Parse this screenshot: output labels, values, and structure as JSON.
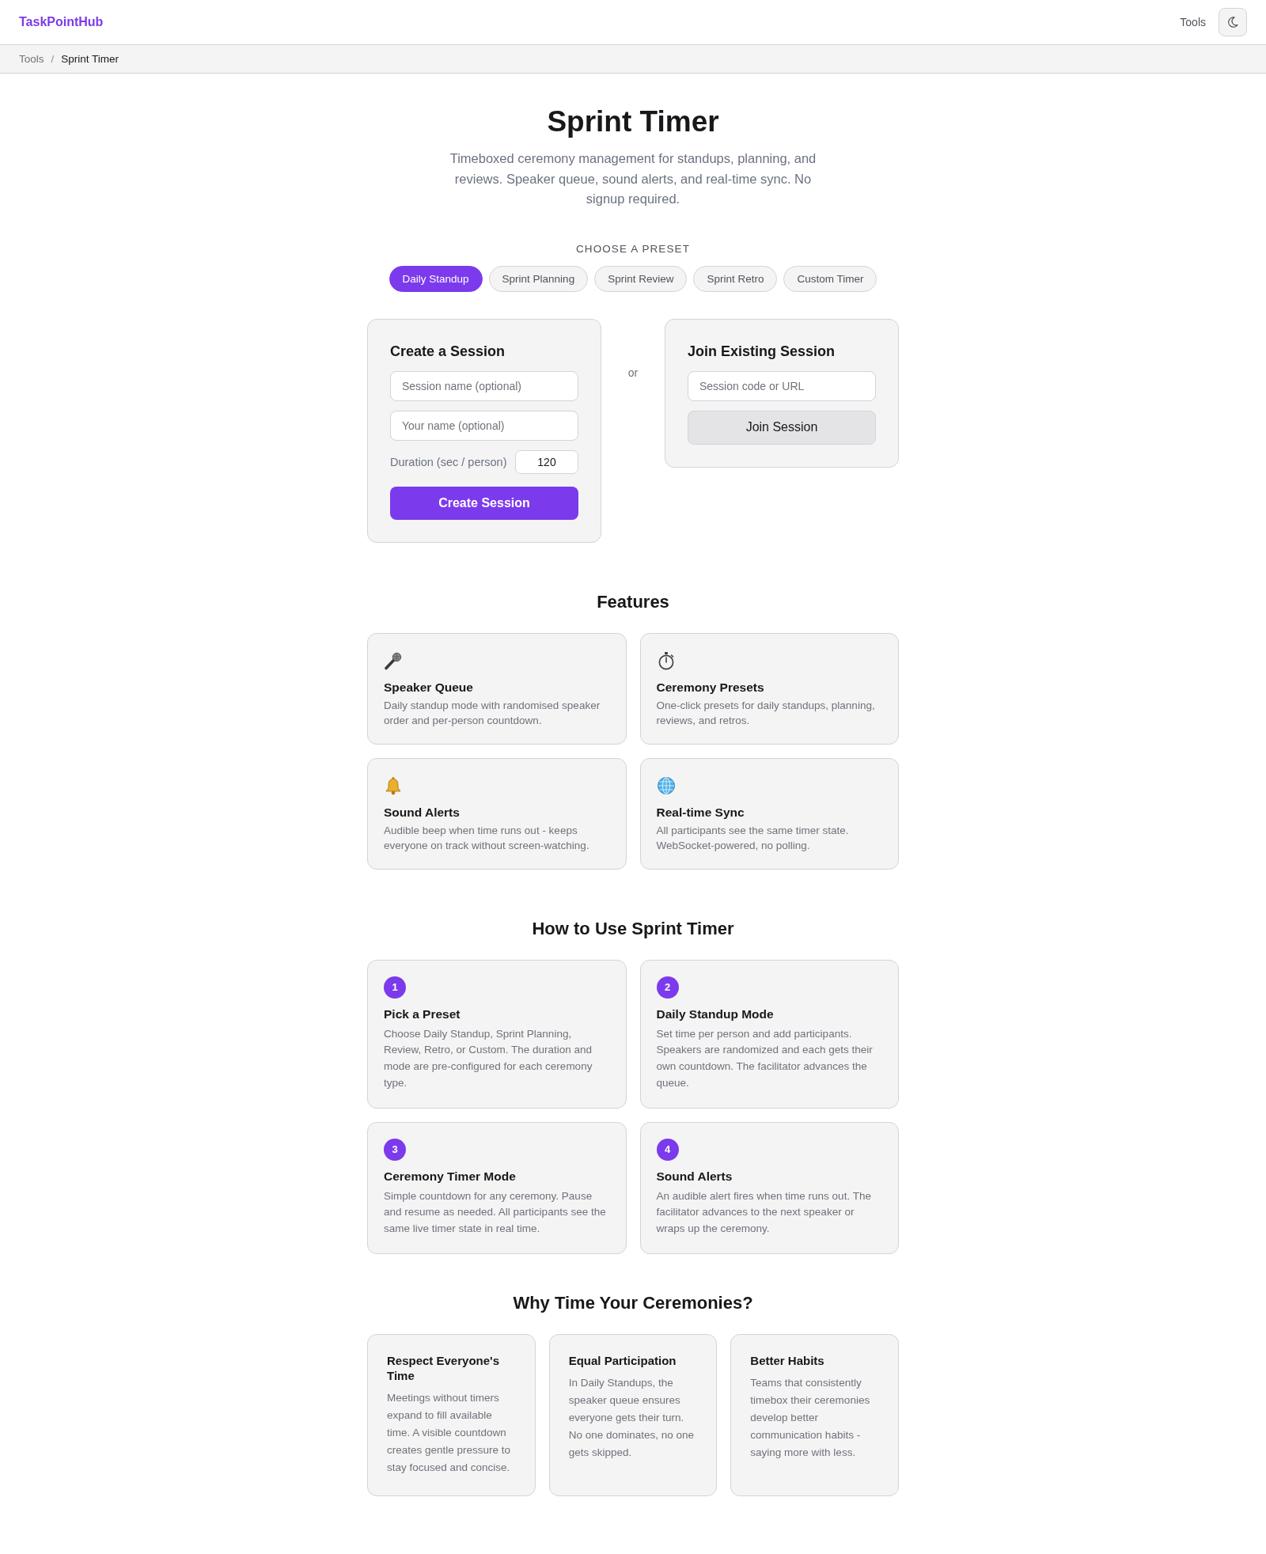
{
  "header": {
    "logo": "TaskPointHub",
    "nav_link": "Tools"
  },
  "breadcrumb": {
    "separator": "/",
    "items": [
      {
        "label": "Tools",
        "current": false
      },
      {
        "label": "Sprint Timer",
        "current": true
      }
    ]
  },
  "hero": {
    "title": "Sprint Timer",
    "subtitle": "Timeboxed ceremony management for standups, planning, and reviews. Speaker queue, sound alerts, and real-time sync. No signup required."
  },
  "presets": {
    "label": "CHOOSE A PRESET",
    "items": [
      {
        "label": "Daily Standup",
        "selected": true
      },
      {
        "label": "Sprint Planning",
        "selected": false
      },
      {
        "label": "Sprint Review",
        "selected": false
      },
      {
        "label": "Sprint Retro",
        "selected": false
      },
      {
        "label": "Custom Timer",
        "selected": false
      }
    ]
  },
  "create_session": {
    "title": "Create a Session",
    "fields": [
      {
        "placeholder": "Session name (optional)"
      },
      {
        "placeholder": "Your name (optional)"
      }
    ],
    "duration": {
      "label": "Duration (sec / person)",
      "value": "120"
    },
    "button": "Create Session"
  },
  "divider_text": "or",
  "join_session": {
    "title": "Join Existing Session",
    "field": {
      "placeholder": "Session code or URL"
    },
    "button": "Join Session"
  },
  "features": {
    "title": "Features",
    "items": [
      {
        "title": "Speaker Queue",
        "description": "Daily standup mode with randomised speaker order and per-person countdown."
      },
      {
        "title": "Ceremony Presets",
        "description": "One-click presets for daily standups, planning, reviews, and retros."
      },
      {
        "title": "Sound Alerts",
        "description": "Audible beep when time runs out - keeps everyone on track without screen-watching."
      },
      {
        "title": "Real-time Sync",
        "description": "All participants see the same timer state. WebSocket-powered, no polling."
      }
    ]
  },
  "how_to": {
    "title": "How to Use Sprint Timer",
    "steps": [
      {
        "number": "1",
        "title": "Pick a Preset",
        "description": "Choose Daily Standup, Sprint Planning, Review, Retro, or Custom. The duration and mode are pre-configured for each ceremony type."
      },
      {
        "number": "2",
        "title": "Daily Standup Mode",
        "description": "Set time per person and add participants. Speakers are randomized and each gets their own countdown. The facilitator advances the queue."
      },
      {
        "number": "3",
        "title": "Ceremony Timer Mode",
        "description": "Simple countdown for any ceremony. Pause and resume as needed. All participants see the same live timer state in real time."
      },
      {
        "number": "4",
        "title": "Sound Alerts",
        "description": "An audible alert fires when time runs out. The facilitator advances to the next speaker or wraps up the ceremony."
      }
    ]
  },
  "why": {
    "title": "Why Time Your Ceremonies?",
    "items": [
      {
        "title": "Respect Everyone's Time",
        "description": "Meetings without timers expand to fill available time. A visible countdown creates gentle pressure to stay focused and concise."
      },
      {
        "title": "Equal Participation",
        "description": "In Daily Standups, the speaker queue ensures everyone gets their turn. No one dominates, no one gets skipped."
      },
      {
        "title": "Better Habits",
        "description": "Teams that consistently timebox their ceremonies develop better communication habits - saying more with less."
      }
    ]
  }
}
